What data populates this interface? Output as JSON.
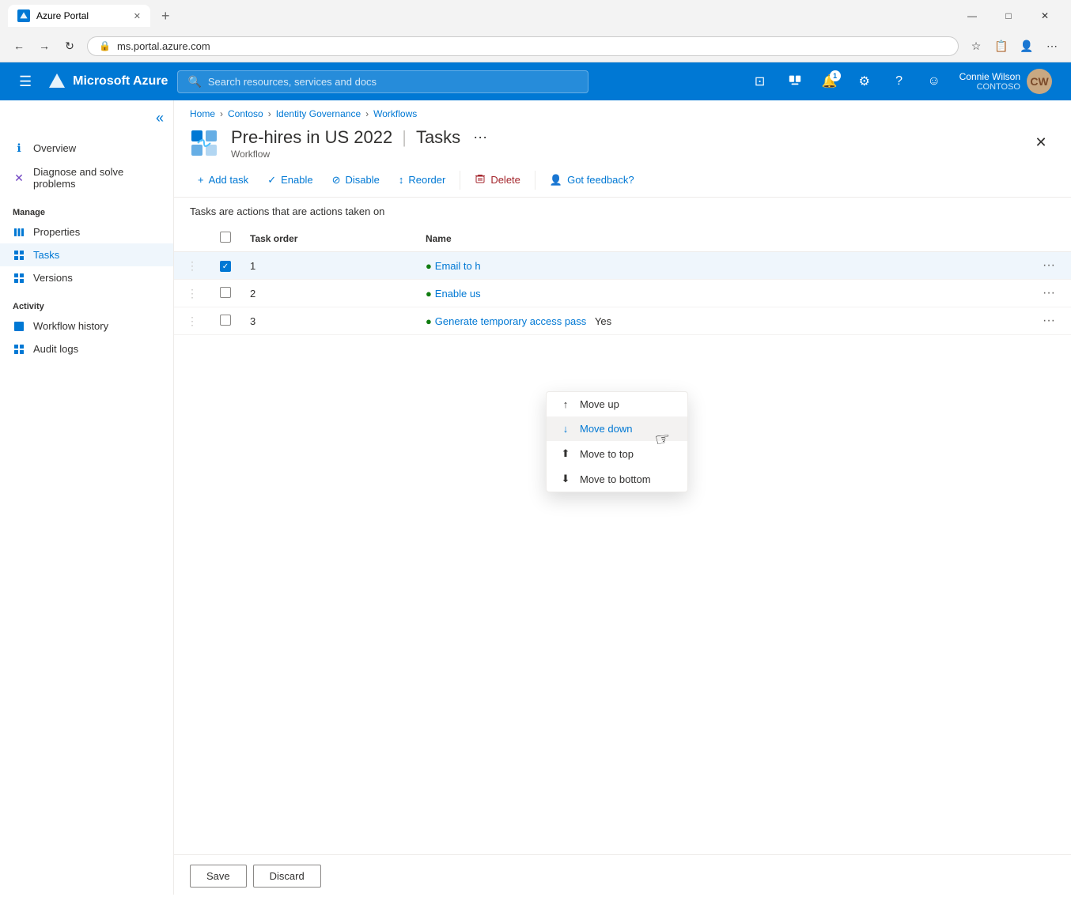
{
  "browser": {
    "tab_title": "Azure Portal",
    "tab_favicon": "A",
    "address": "ms.portal.azure.com",
    "new_tab_label": "+",
    "window_controls": {
      "minimize": "—",
      "maximize": "□",
      "close": "✕"
    }
  },
  "topnav": {
    "hamburger_icon": "☰",
    "logo_text": "Microsoft Azure",
    "search_placeholder": "Search resources, services and docs",
    "cloud_icon": "☁",
    "feedback_icon": "⊡",
    "notifications_icon": "🔔",
    "notification_count": "1",
    "settings_icon": "⚙",
    "help_icon": "?",
    "smiley_icon": "☺",
    "user_name": "Connie Wilson",
    "user_org": "CONTOSO",
    "avatar_initials": "CW"
  },
  "breadcrumb": {
    "home": "Home",
    "contoso": "Contoso",
    "identity_governance": "Identity Governance",
    "workflows": "Workflows"
  },
  "page": {
    "title": "Pre-hires in US 2022",
    "subtitle": "Workflow",
    "section": "Tasks",
    "more_icon": "···",
    "close_icon": "✕"
  },
  "toolbar": {
    "add_task_label": "+ Add task",
    "enable_label": "✓ Enable",
    "disable_label": "Disable",
    "reorder_label": "↕ Reorder",
    "delete_label": "Delete",
    "feedback_label": "Got feedback?"
  },
  "description": "Tasks are actions that are actions taken on",
  "table": {
    "col_task_order": "Task order",
    "col_name": "Name",
    "rows": [
      {
        "order": "1",
        "status_icon": "●",
        "name": "Email to h",
        "selected": true
      },
      {
        "order": "2",
        "status_icon": "●",
        "name": "Enable us",
        "selected": false
      },
      {
        "order": "3",
        "status_icon": "●",
        "name": "Generate temporary access pass",
        "extra": "Yes",
        "selected": false
      }
    ]
  },
  "context_menu": {
    "items": [
      {
        "icon": "↑",
        "label": "Move up"
      },
      {
        "icon": "↓",
        "label": "Move down",
        "active": true
      },
      {
        "icon": "⇡",
        "label": "Move to top"
      },
      {
        "icon": "⇣",
        "label": "Move to bottom"
      }
    ]
  },
  "sidebar": {
    "collapse_icon": "«",
    "sections": [
      {
        "items": [
          {
            "id": "overview",
            "icon": "ℹ",
            "label": "Overview",
            "icon_color": "blue"
          },
          {
            "id": "diagnose",
            "icon": "✕",
            "label": "Diagnose and solve problems",
            "icon_color": "purple"
          }
        ]
      },
      {
        "title": "Manage",
        "items": [
          {
            "id": "properties",
            "icon": "|||",
            "label": "Properties",
            "icon_color": "blue"
          },
          {
            "id": "tasks",
            "icon": "▣",
            "label": "Tasks",
            "icon_color": "blue",
            "active": true
          },
          {
            "id": "versions",
            "icon": "▣",
            "label": "Versions",
            "icon_color": "blue"
          }
        ]
      },
      {
        "title": "Activity",
        "items": [
          {
            "id": "workflow-history",
            "icon": "■",
            "label": "Workflow history",
            "icon_color": "blue"
          },
          {
            "id": "audit-logs",
            "icon": "▣",
            "label": "Audit logs",
            "icon_color": "blue"
          }
        ]
      }
    ]
  },
  "footer": {
    "save_label": "Save",
    "discard_label": "Discard"
  }
}
